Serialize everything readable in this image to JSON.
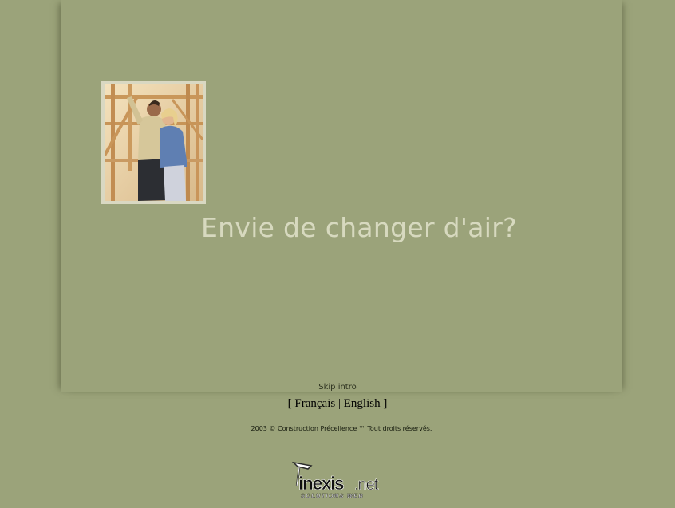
{
  "hero": {
    "headline": "Envie de changer d'air?",
    "photo_icon": "couple-at-construction-site-photo"
  },
  "intro": {
    "skip_label": "Skip intro"
  },
  "language": {
    "open_bracket": "[",
    "french_label": "Français",
    "separator": "|",
    "english_label": "English",
    "close_bracket": "]"
  },
  "footer": {
    "copyright": "2003 © Construction Précellence ™ Tout droits réservés.",
    "logo_text": "inexis.net",
    "logo_tagline": "SOLUTIONS WEB"
  },
  "colors": {
    "background": "#9ba37a",
    "headline": "#d7d9bf",
    "frame": "#d9d8c2"
  }
}
